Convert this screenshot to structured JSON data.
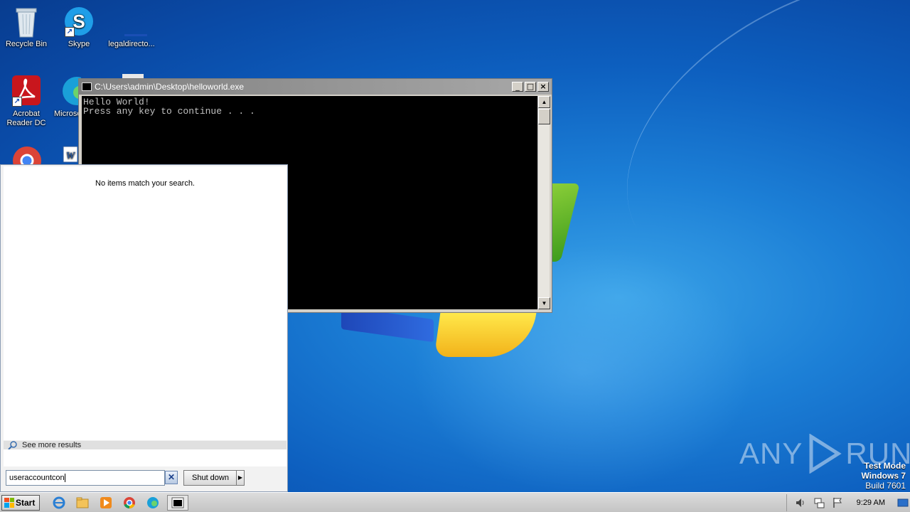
{
  "desktop": {
    "icons": [
      {
        "label": "Recycle Bin"
      },
      {
        "label": "Skype"
      },
      {
        "label": "legaldirecto..."
      },
      {
        "label": "Acrobat Reader DC"
      },
      {
        "label": "Microso"
      }
    ]
  },
  "console": {
    "title": "C:\\Users\\admin\\Desktop\\helloworld.exe",
    "output": "Hello World!\nPress any key to continue . . ."
  },
  "start_menu": {
    "no_results_text": "No items match your search.",
    "see_more_label": "See more results",
    "search_value": "useraccountcon",
    "shutdown_label": "Shut down"
  },
  "watermark": {
    "brand": "ANY RUN",
    "line1": "Test Mode",
    "line2": "Windows 7",
    "line3": "Build 7601"
  },
  "taskbar": {
    "start_label": "Start",
    "clock": "9:29 AM"
  },
  "colors": {
    "desktop_bg": "#0d5fbf",
    "console_bg": "#000000",
    "console_text": "#c0c0c0"
  }
}
